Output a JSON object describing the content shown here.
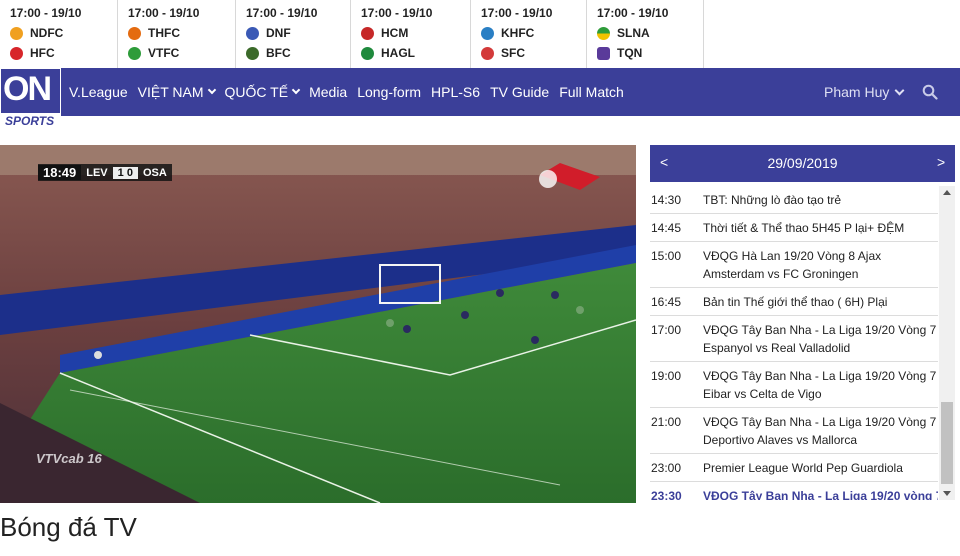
{
  "matches": [
    {
      "time": "17:00 - 19/10",
      "home": "NDFC",
      "away": "HFC",
      "home_color": "#f0a020",
      "away_color": "#d7262a"
    },
    {
      "time": "17:00 - 19/10",
      "home": "THFC",
      "away": "VTFC",
      "home_color": "#e46b10",
      "away_color": "#2e9c3a"
    },
    {
      "time": "17:00 - 19/10",
      "home": "DNF",
      "away": "BFC",
      "home_color": "#3a59b5",
      "away_color": "#3b6a2a"
    },
    {
      "time": "17:00 - 19/10",
      "home": "HCM",
      "away": "HAGL",
      "home_color": "#c62828",
      "away_color": "#1f8a3d"
    },
    {
      "time": "17:00 - 19/10",
      "home": "KHFC",
      "away": "SFC",
      "home_color": "#2a7fc4",
      "away_color": "#d33a3a"
    },
    {
      "time": "17:00 - 19/10",
      "home": "SLNA",
      "away": "TQN",
      "home_color": "#f2c200",
      "away_color": "#5a3b9a"
    }
  ],
  "brand": {
    "on": "ON",
    "sports": "SPORTS"
  },
  "nav": {
    "items": [
      "V.League",
      "VIỆT NAM",
      "QUỐC TẾ",
      "Media",
      "Long-form",
      "HPL-S6",
      "TV Guide",
      "Full Match"
    ],
    "user": "Pham Huy"
  },
  "video": {
    "clock": "18:49",
    "home": "LEV",
    "score": "1  0",
    "away": "OSA",
    "channel_logo": "VTVcab 16"
  },
  "schedule": {
    "date": "29/09/2019",
    "prev": "<",
    "next": ">",
    "rows": [
      {
        "time": "14:30",
        "program": "TBT: Những lò đào tạo trẻ"
      },
      {
        "time": "14:45",
        "program": "Thời tiết & Thể thao 5H45 P lại+ ĐỆM"
      },
      {
        "time": "15:00",
        "program": "VĐQG Hà Lan 19/20 Vòng 8 Ajax Amsterdam vs FC Groningen"
      },
      {
        "time": "16:45",
        "program": "Bản tin Thế giới thể thao ( 6H) Plại"
      },
      {
        "time": "17:00",
        "program": "VĐQG Tây Ban Nha - La Liga 19/20 Vòng 7 Espanyol vs Real Valladolid"
      },
      {
        "time": "19:00",
        "program": "VĐQG Tây Ban Nha - La Liga 19/20 Vòng 7 Eibar vs Celta de Vigo"
      },
      {
        "time": "21:00",
        "program": "VĐQG Tây Ban Nha - La Liga 19/20 Vòng 7 Deportivo Alaves vs Mallorca"
      },
      {
        "time": "23:00",
        "program": "Premier League World Pep Guardiola"
      },
      {
        "time": "23:30",
        "program": "VĐQG Tây Ban Nha - La Liga 19/20 vòng 7"
      }
    ]
  },
  "page": {
    "title": "Bóng đá TV"
  },
  "colors": {
    "brand": "#3b3f99",
    "pitch": "#2f7a2f"
  }
}
